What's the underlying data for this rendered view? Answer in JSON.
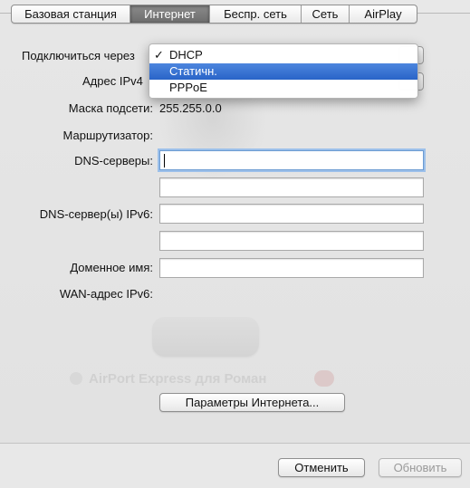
{
  "tabs": [
    {
      "label": "Базовая станция",
      "selected": false
    },
    {
      "label": "Интернет",
      "selected": true
    },
    {
      "label": "Беспр. сеть",
      "selected": false
    },
    {
      "label": "Сеть",
      "selected": false
    },
    {
      "label": "AirPlay",
      "selected": false
    }
  ],
  "form": {
    "connect_label": "Подключиться через",
    "ipv4_label": "Адрес IPv4",
    "mask_label": "Маска подсети:",
    "mask_value": "255.255.0.0",
    "router_label": "Маршрутизатор:",
    "dns_label": "DNS-серверы:",
    "dns6_label": "DNS-сервер(ы) IPv6:",
    "domain_label": "Доменное имя:",
    "wan6_label": "WAN-адрес IPv6:",
    "dns1_value": "",
    "dns2_value": "",
    "dns6_1_value": "",
    "dns6_2_value": "",
    "domain_value": ""
  },
  "connect_menu": {
    "items": [
      "DHCP",
      "Статичн.",
      "PPPoE"
    ],
    "checked": "DHCP",
    "highlighted": "Статичн.",
    "check_glyph": "✓"
  },
  "background": {
    "device_name": "AirPort Express для Роман"
  },
  "buttons": {
    "internet_options": "Параметры Интернета...",
    "cancel": "Отменить",
    "update": "Обновить"
  },
  "colors": {
    "highlight": "#2f6dd0",
    "selected_tab": "#7a7a7a"
  }
}
